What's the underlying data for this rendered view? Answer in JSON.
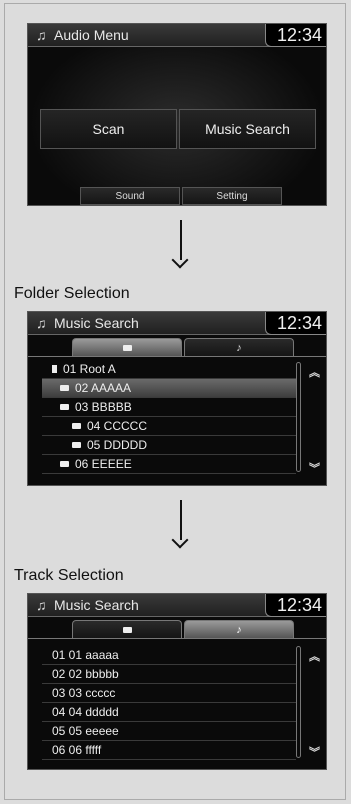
{
  "screen1": {
    "title": "Audio Menu",
    "clock": "12:34",
    "buttons": {
      "scan": "Scan",
      "music_search": "Music Search",
      "sound": "Sound",
      "setting": "Setting"
    }
  },
  "step1_label": "Folder Selection",
  "screen2": {
    "title": "Music Search",
    "clock": "12:34",
    "items": [
      "01 Root A",
      "02 AAAAA",
      "03 BBBBB",
      "04 CCCCC",
      "05 DDDDD",
      "06 EEEEE"
    ]
  },
  "step2_label": "Track Selection",
  "screen3": {
    "title": "Music Search",
    "clock": "12:34",
    "items": [
      "01 01 aaaaa",
      "02 02 bbbbb",
      "03 03 ccccc",
      "04 04 ddddd",
      "05 05 eeeee",
      "06 06 fffff"
    ]
  },
  "icons": {
    "note": "music-note-icon",
    "folder": "folder-icon",
    "down": "arrow-down-icon"
  }
}
